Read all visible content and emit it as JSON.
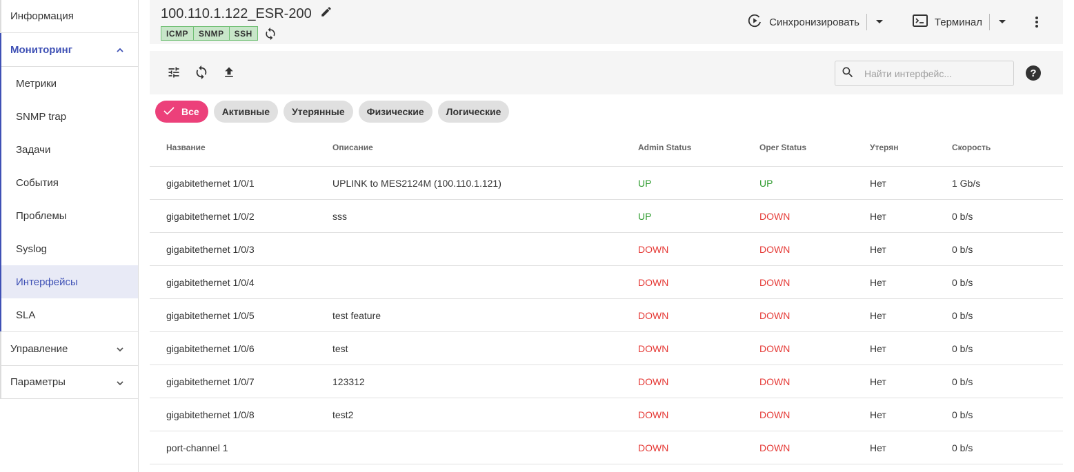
{
  "sidebar": {
    "info": "Информация",
    "monitoring": {
      "label": "Мониторинг",
      "items": [
        "Метрики",
        "SNMP trap",
        "Задачи",
        "События",
        "Проблемы",
        "Syslog",
        "Интерфейсы",
        "SLA"
      ],
      "active": "Интерфейсы"
    },
    "management": "Управление",
    "parameters": "Параметры"
  },
  "header": {
    "title": "100.110.1.122_ESR-200",
    "badges": [
      "ICMP",
      "SNMP",
      "SSH"
    ],
    "sync_label": "Синхронизировать",
    "terminal_label": "Терминал"
  },
  "toolbar": {
    "search_placeholder": "Найти интерфейс...",
    "help": "?"
  },
  "filters": {
    "chips": [
      "Все",
      "Активные",
      "Утерянные",
      "Физические",
      "Логические"
    ],
    "active": "Все"
  },
  "table": {
    "columns": [
      "Название",
      "Описание",
      "Admin Status",
      "Oper Status",
      "Утерян",
      "Скорость"
    ],
    "rows": [
      {
        "name": "gigabitethernet 1/0/1",
        "desc": "UPLINK to MES2124M (100.110.1.121)",
        "admin": "UP",
        "oper": "UP",
        "lost": "Нет",
        "speed": "1 Gb/s"
      },
      {
        "name": "gigabitethernet 1/0/2",
        "desc": "sss",
        "admin": "UP",
        "oper": "DOWN",
        "lost": "Нет",
        "speed": "0 b/s"
      },
      {
        "name": "gigabitethernet 1/0/3",
        "desc": "",
        "admin": "DOWN",
        "oper": "DOWN",
        "lost": "Нет",
        "speed": "0 b/s"
      },
      {
        "name": "gigabitethernet 1/0/4",
        "desc": "",
        "admin": "DOWN",
        "oper": "DOWN",
        "lost": "Нет",
        "speed": "0 b/s"
      },
      {
        "name": "gigabitethernet 1/0/5",
        "desc": "test feature",
        "admin": "DOWN",
        "oper": "DOWN",
        "lost": "Нет",
        "speed": "0 b/s"
      },
      {
        "name": "gigabitethernet 1/0/6",
        "desc": "test",
        "admin": "DOWN",
        "oper": "DOWN",
        "lost": "Нет",
        "speed": "0 b/s"
      },
      {
        "name": "gigabitethernet 1/0/7",
        "desc": "123312",
        "admin": "DOWN",
        "oper": "DOWN",
        "lost": "Нет",
        "speed": "0 b/s"
      },
      {
        "name": "gigabitethernet 1/0/8",
        "desc": "test2",
        "admin": "DOWN",
        "oper": "DOWN",
        "lost": "Нет",
        "speed": "0 b/s"
      },
      {
        "name": "port-channel 1",
        "desc": "",
        "admin": "DOWN",
        "oper": "DOWN",
        "lost": "Нет",
        "speed": "0 b/s"
      }
    ]
  },
  "colors": {
    "accent": "#3f51b5",
    "chip_active": "#ec407a",
    "status_up": "#2e9b2e",
    "status_down": "#e53935",
    "badge_bg": "#c8e6c9"
  }
}
